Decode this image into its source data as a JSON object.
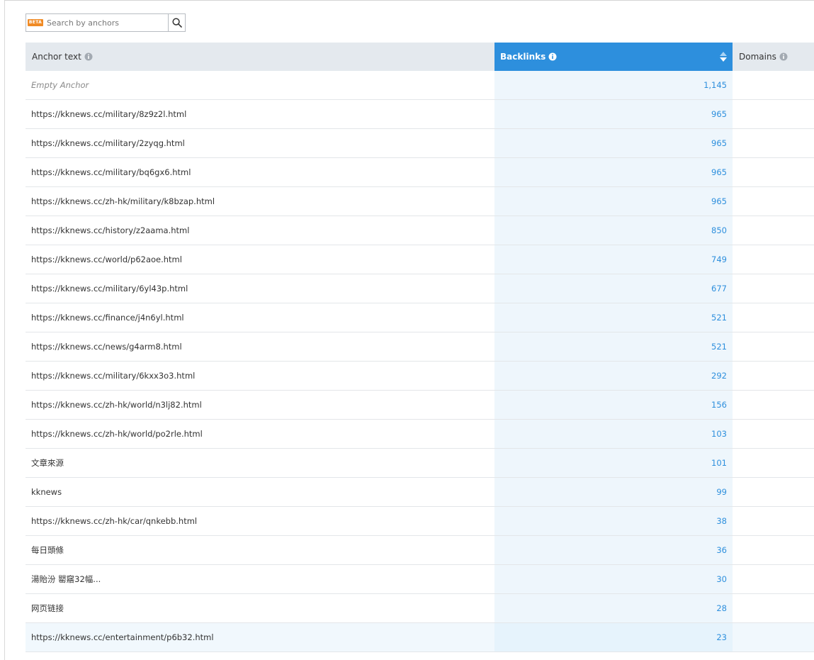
{
  "search": {
    "badge": "BETA",
    "placeholder": "Search by anchors"
  },
  "columns": {
    "anchor_text": "Anchor text",
    "backlinks": "Backlinks",
    "domains": "Domains"
  },
  "rows": [
    {
      "anchor": "Empty Anchor",
      "backlinks": "1,145"
    },
    {
      "anchor": "https://kknews.cc/military/8z9z2l.html",
      "backlinks": "965"
    },
    {
      "anchor": "https://kknews.cc/military/2zyqg.html",
      "backlinks": "965"
    },
    {
      "anchor": "https://kknews.cc/military/bq6gx6.html",
      "backlinks": "965"
    },
    {
      "anchor": "https://kknews.cc/zh-hk/military/k8bzap.html",
      "backlinks": "965"
    },
    {
      "anchor": "https://kknews.cc/history/z2aama.html",
      "backlinks": "850"
    },
    {
      "anchor": "https://kknews.cc/world/p62aoe.html",
      "backlinks": "749"
    },
    {
      "anchor": "https://kknews.cc/military/6yl43p.html",
      "backlinks": "677"
    },
    {
      "anchor": "https://kknews.cc/finance/j4n6yl.html",
      "backlinks": "521"
    },
    {
      "anchor": "https://kknews.cc/news/g4arm8.html",
      "backlinks": "521"
    },
    {
      "anchor": "https://kknews.cc/military/6kxx3o3.html",
      "backlinks": "292"
    },
    {
      "anchor": "https://kknews.cc/zh-hk/world/n3lj82.html",
      "backlinks": "156"
    },
    {
      "anchor": "https://kknews.cc/zh-hk/world/po2rle.html",
      "backlinks": "103"
    },
    {
      "anchor": "文章來源",
      "backlinks": "101"
    },
    {
      "anchor": "kknews",
      "backlinks": "99"
    },
    {
      "anchor": "https://kknews.cc/zh-hk/car/qnkebb.html",
      "backlinks": "38"
    },
    {
      "anchor": "每日頭條",
      "backlinks": "36"
    },
    {
      "anchor": "湯貽汾 罌窹32幅...",
      "backlinks": "30"
    },
    {
      "anchor": "网页链接",
      "backlinks": "28"
    },
    {
      "anchor": "https://kknews.cc/entertainment/p6b32.html",
      "backlinks": "23"
    }
  ],
  "colors": {
    "accent": "#2d8fdd",
    "header_bg": "#e4e9ee",
    "beta_badge": "#f08a24"
  }
}
